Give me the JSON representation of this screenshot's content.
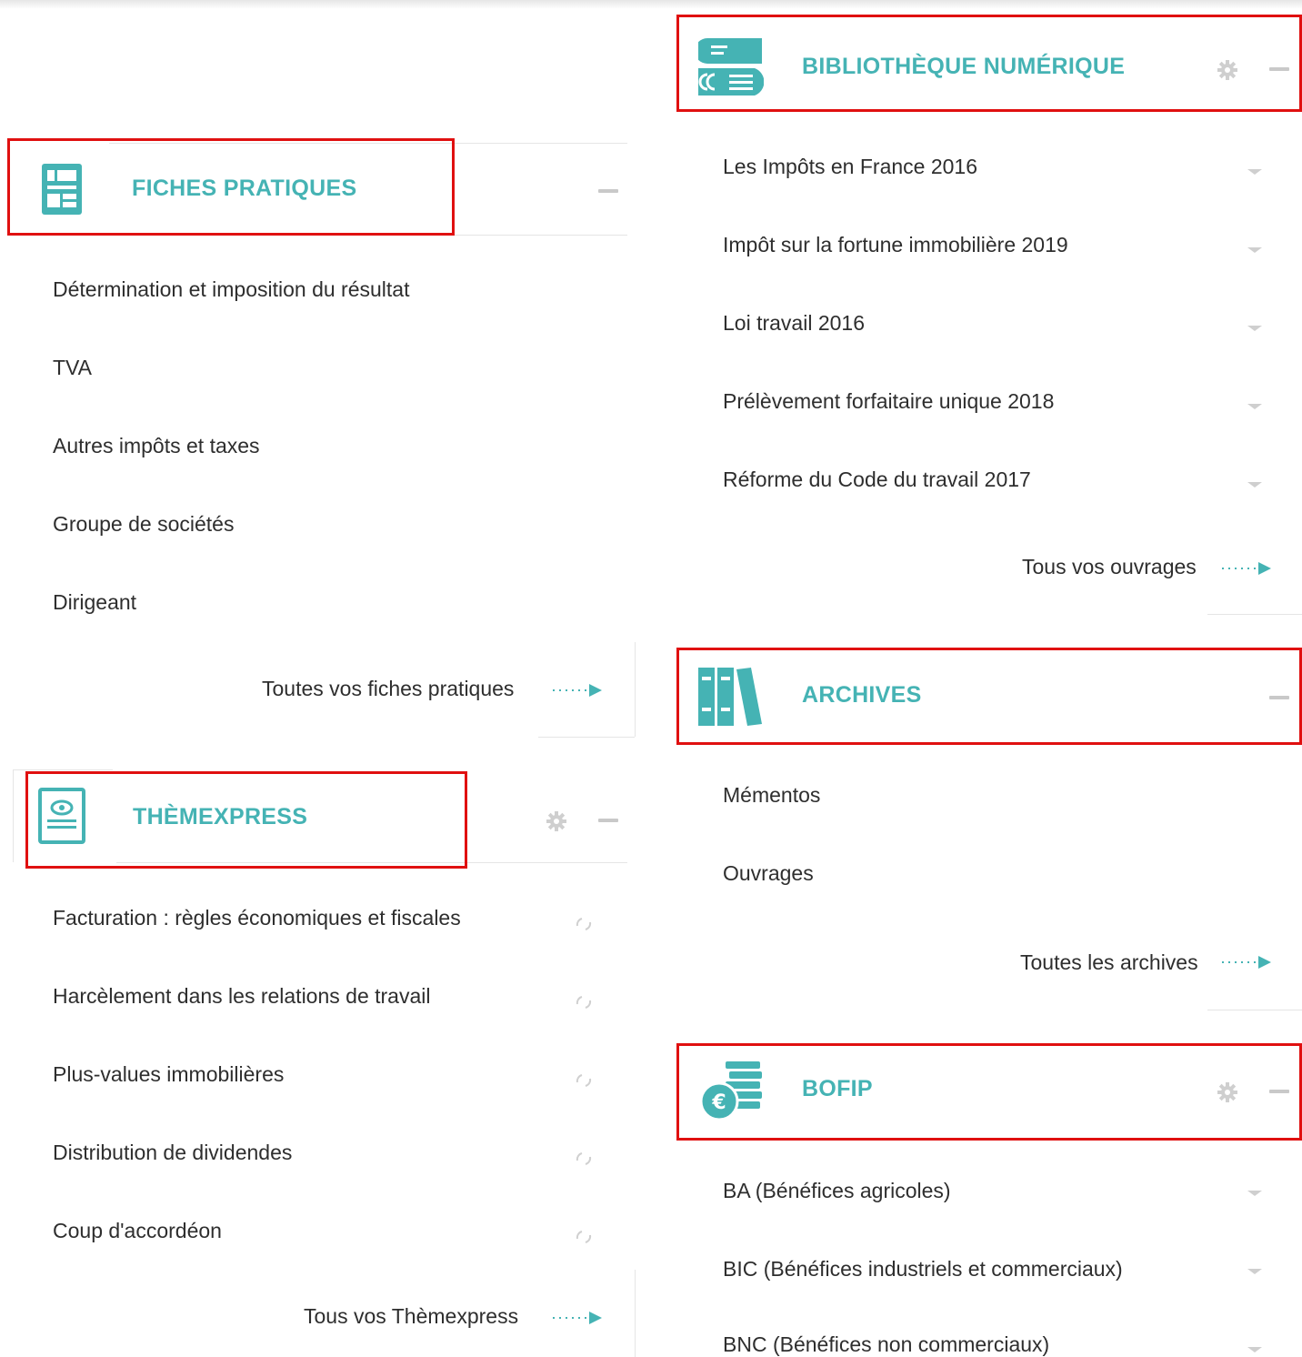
{
  "fiches": {
    "title": "FICHES PRATIQUES",
    "items": [
      "Détermination et imposition du résultat",
      "TVA",
      "Autres impôts et taxes",
      "Groupe de sociétés",
      "Dirigeant"
    ],
    "more": "Toutes vos fiches pratiques"
  },
  "themexpress": {
    "title": "THÈMEXPRESS",
    "items": [
      "Facturation : règles économiques et fiscales",
      "Harcèlement dans les relations de travail",
      "Plus-values immobilières",
      "Distribution de dividendes",
      "Coup d'accordéon"
    ],
    "more": "Tous vos Thèmexpress"
  },
  "bibliotheque": {
    "title": "BIBLIOTHÈQUE NUMÉRIQUE",
    "items": [
      "Les Impôts en France 2016",
      "Impôt sur la fortune immobilière 2019",
      "Loi travail 2016",
      "Prélèvement forfaitaire unique 2018",
      "Réforme du Code du travail 2017"
    ],
    "more": "Tous vos ouvrages"
  },
  "archives": {
    "title": "ARCHIVES",
    "items": [
      "Mémentos",
      "Ouvrages"
    ],
    "more": "Toutes les archives"
  },
  "bofip": {
    "title": "BOFIP",
    "items": [
      "BA (Bénéfices agricoles)",
      "BIC (Bénéfices industriels et commerciaux)",
      "BNC (Bénéfices non commerciaux)"
    ]
  },
  "icons": {
    "fiches": "fiches-document-icon",
    "themexpress": "themexpress-eye-document-icon",
    "bibliotheque": "books-stack-icon",
    "archives": "binders-icon",
    "bofip": "euro-coins-icon",
    "settings": "gear-icon",
    "collapse": "minus-icon",
    "expand": "caret-down-icon",
    "loading": "spinner-icon",
    "more": "dotted-arrow-icon"
  },
  "colors": {
    "accent": "#45b3b4",
    "highlight": "#e01010",
    "text": "#2e2e2e"
  }
}
